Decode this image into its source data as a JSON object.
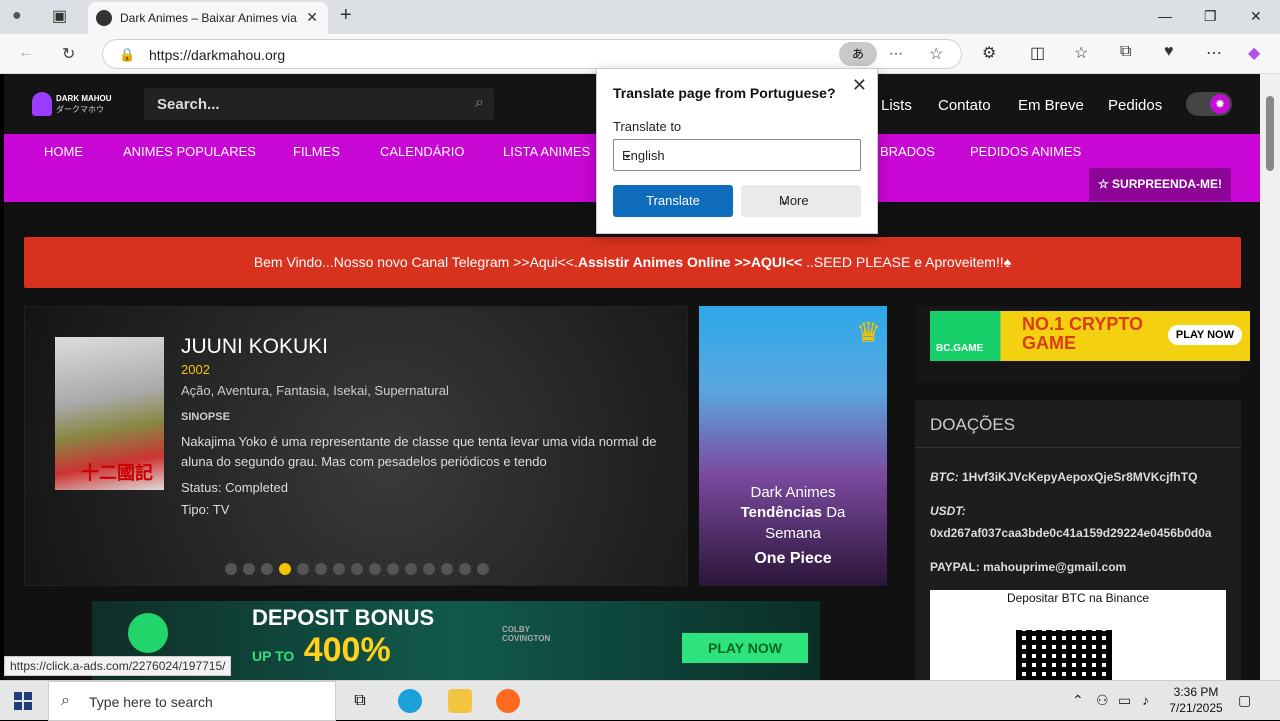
{
  "browser": {
    "tab_title": "Dark Animes – Baixar Animes via Torrent",
    "url": "https://darkmahou.org"
  },
  "site": {
    "logo_line1": "DARK MAHOU",
    "logo_line2": "ダークマホウ",
    "search_placeholder": "Search...",
    "top_links": [
      "Lists",
      "Contato",
      "Em Breve",
      "Pedidos"
    ],
    "nav": [
      "HOME",
      "ANIMES POPULARES",
      "FILMES",
      "CALENDÁRIO",
      "LISTA ANIMES",
      "BRADOS",
      "PEDIDOS ANIMES"
    ],
    "surprise_label": "☆ SURPREENDA-ME!",
    "banner_part1": "Bem Vindo...Nosso novo Canal Telegram >>Aqui<<.",
    "banner_part2": "Assistir Animes Online >>AQUI<<",
    "banner_part3": " ..SEED PLEASE e Aproveitem!!♠"
  },
  "featured": {
    "title": "JUUNI KOKUKI",
    "year": "2002",
    "genres": "Ação, Aventura, Fantasia, Isekai, Supernatural",
    "synopsis_label": "SINOPSE",
    "synopsis": "Nakajima Yoko é uma representante de classe que tenta levar uma vida normal de aluna do segundo grau. Mas com pesadelos periódicos e tendo",
    "status": "Status: Completed",
    "type": "Tipo: TV",
    "poster_text": "十二國記",
    "dot_count": 15,
    "active_dot": 3
  },
  "trend": {
    "line1": "Dark Animes",
    "line2_bold": "Tendências",
    "line2_rest": " Da",
    "line3": "Semana",
    "line4": "One Piece"
  },
  "ads": {
    "bc_logo": "BC.GAME",
    "bc_headline": "NO.1 CRYPTO GAME",
    "bc_play": "PLAY NOW",
    "deposit_h1": "DEPOSIT BONUS",
    "deposit_upto": "UP TO",
    "deposit_pct": "400%",
    "deposit_name": "COLBY COVINGTON",
    "deposit_play": "PLAY NOW"
  },
  "donations": {
    "title": "DOAÇÕES",
    "btc_label": "BTC:",
    "btc_value": " 1Hvf3iKJVcKepyAepoxQjeSr8MVKcjfhTQ",
    "usdt_label": "USDT:",
    "usdt_value": "0xd267af037caa3bde0c41a159d29224e0456b0d0a",
    "paypal_label": "PAYPAL:",
    "paypal_value": " mahouprime@gmail.com",
    "qr_caption": "Depositar BTC na Binance"
  },
  "status_url": "https://click.a-ads.com/2276024/197715/",
  "translate": {
    "title": "Translate page from Portuguese?",
    "to_label": "Translate to",
    "language": "English",
    "translate_btn": "Translate",
    "more_btn": "More"
  },
  "taskbar": {
    "search_placeholder": "Type here to search",
    "time": "3:36 PM",
    "date": "7/21/2025"
  },
  "colors": {
    "nav_bg": "#c807d4",
    "banner_bg": "#d8321f",
    "accent_yellow": "#f4c400",
    "translate_btn": "#0f6cbd"
  }
}
